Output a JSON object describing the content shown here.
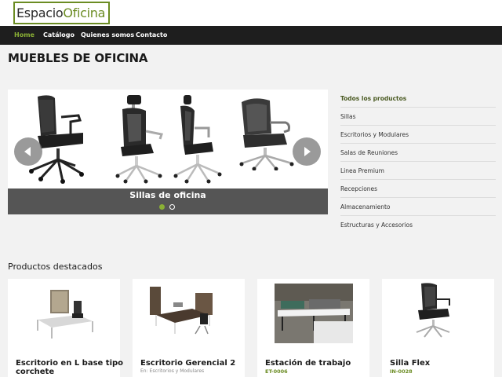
{
  "logo": {
    "part1": "Espacio",
    "part2": "Oficina"
  },
  "nav": [
    "Home",
    "Catálogo",
    "Quienes somos",
    "Contacto"
  ],
  "page_title": "MUEBLES DE OFICINA",
  "slider": {
    "caption": "Sillas de oficina"
  },
  "sidebar": [
    "Todos los productos",
    "Sillas",
    "Escritorios y Modulares",
    "Salas de Reuniones",
    "Linea Premium",
    "Recepciones",
    "Almacenamiento",
    "Estructuras y Accesorios"
  ],
  "featured": {
    "title": "Productos destacados",
    "products": [
      {
        "name": "Escritorio en L base tipo corchete",
        "sub": "",
        "code": ""
      },
      {
        "name": "Escritorio Gerencial 2",
        "sub": "En: Escritorios y Modulares",
        "code": ""
      },
      {
        "name": "Estación de trabajo",
        "sub": "",
        "code": "ET-0006"
      },
      {
        "name": "Silla Flex",
        "sub": "",
        "code": "IN-0028"
      }
    ]
  },
  "colors": {
    "accent": "#8ab035",
    "logo_green": "#6b8c23",
    "nav_bg": "#1e1e1e"
  }
}
